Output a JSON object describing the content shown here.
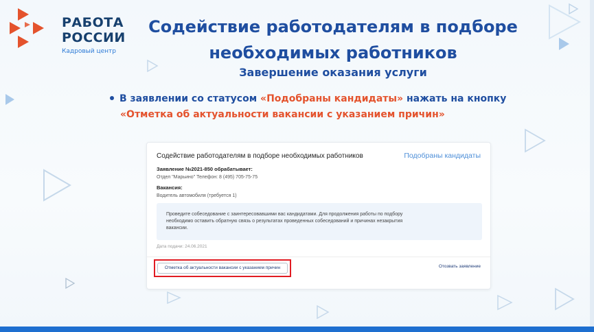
{
  "logo": {
    "line1": "РАБОТА",
    "line2": "РОССИИ",
    "subtitle": "Кадровый центр"
  },
  "heading": {
    "title_line1": "Содействие  работодателям в подборе",
    "title_line2": "необходимых работников",
    "subtitle": "Завершение оказания услуги"
  },
  "instruction": {
    "part1": "В заявлении со статусом ",
    "accent1": "«Подобраны кандидаты»",
    "part2": " нажать на кнопку",
    "accent2": "«Отметка об актуальности вакансии с указанием причин»"
  },
  "card": {
    "title": "Содействие работодателям в подборе необходимых работников",
    "status": "Подобраны кандидаты",
    "application_label": "Заявление №2021-850 обрабатывает:",
    "application_value": "Отдел \"Марьино\" Телефон: 8 (495) 705-75-75",
    "vacancy_label": "Вакансия:",
    "vacancy_value": "Водитель автомобиля (требуется 1)",
    "info_text": "Проведите собеседование с заинтересовавшими вас кандидатами. Для продолжения работы по подбору необходимо оставить обратную связь о результатах проведенных собеседований и причинах незакрытия вакансии.",
    "date": "Дата подачи: 24.06.2021",
    "action_button": "Отметка об актуальности вакансии с указанием причин",
    "withdraw_link": "Отозвать заявление"
  },
  "colors": {
    "primary": "#1f4ea0",
    "accent": "#e4532d",
    "logo_red": "#e4532d",
    "highlight": "#e11b22",
    "status_blue": "#4e8fd8",
    "bottom_bar": "#1e6fd0"
  }
}
